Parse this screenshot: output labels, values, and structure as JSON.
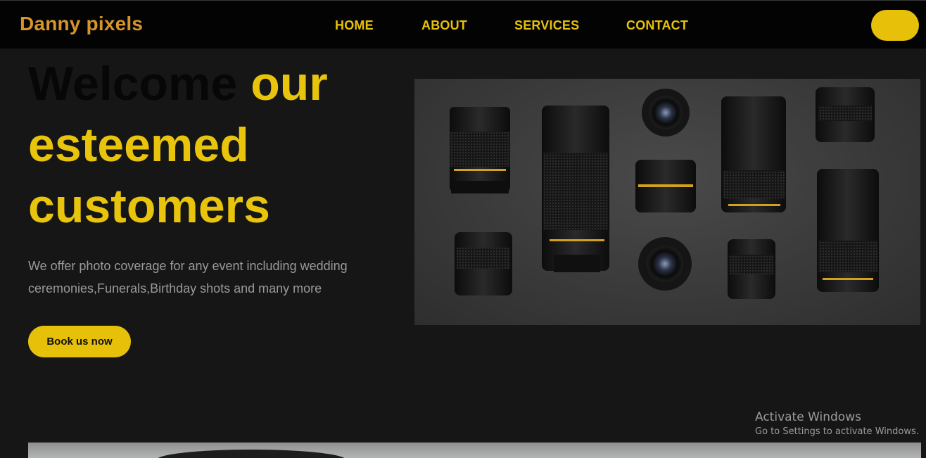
{
  "brand": {
    "name": "Danny pixels"
  },
  "nav": {
    "links": [
      "HOME",
      "ABOUT",
      "SERVICES",
      "CONTACT"
    ]
  },
  "hero": {
    "title_dark": "Welcome",
    "title_accent_1": "our",
    "title_accent_2": "esteemed",
    "title_accent_3": "customers",
    "description": "We offer photo coverage for any event including wedding ceremonies,Funerals,Birthday shots and many more",
    "button_label": "Book us now",
    "image_icon": "camera-lenses-photo"
  },
  "bottom_image": {
    "icon": "camera-lens-photo"
  },
  "watermark": {
    "title": "Activate Windows",
    "subtitle": "Go to Settings to activate Windows."
  },
  "colors": {
    "accent": "#e7c00a",
    "brand": "#d6942a",
    "background": "#161616",
    "navbar": "#030303",
    "text_muted": "#9a9a9a"
  }
}
